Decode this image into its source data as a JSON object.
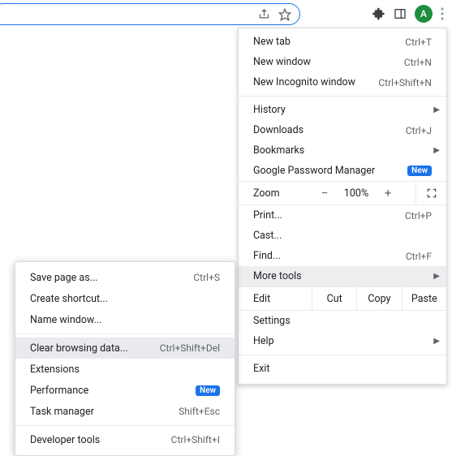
{
  "toolbar": {
    "avatar_letter": "A"
  },
  "menu": {
    "new_tab": {
      "label": "New tab",
      "accel": "Ctrl+T"
    },
    "new_window": {
      "label": "New window",
      "accel": "Ctrl+N"
    },
    "new_incognito": {
      "label": "New Incognito window",
      "accel": "Ctrl+Shift+N"
    },
    "history": {
      "label": "History"
    },
    "downloads": {
      "label": "Downloads",
      "accel": "Ctrl+J"
    },
    "bookmarks": {
      "label": "Bookmarks"
    },
    "password_mgr": {
      "label": "Google Password Manager",
      "badge": "New"
    },
    "zoom": {
      "label": "Zoom",
      "pct": "100%"
    },
    "print": {
      "label": "Print...",
      "accel": "Ctrl+P"
    },
    "cast": {
      "label": "Cast..."
    },
    "find": {
      "label": "Find...",
      "accel": "Ctrl+F"
    },
    "more_tools": {
      "label": "More tools"
    },
    "edit": {
      "label": "Edit",
      "cut": "Cut",
      "copy": "Copy",
      "paste": "Paste"
    },
    "settings": {
      "label": "Settings"
    },
    "help": {
      "label": "Help"
    },
    "exit": {
      "label": "Exit"
    }
  },
  "submenu": {
    "save_page": {
      "label": "Save page as...",
      "accel": "Ctrl+S"
    },
    "create_shortcut": {
      "label": "Create shortcut..."
    },
    "name_window": {
      "label": "Name window..."
    },
    "clear_data": {
      "label": "Clear browsing data...",
      "accel": "Ctrl+Shift+Del"
    },
    "extensions": {
      "label": "Extensions"
    },
    "performance": {
      "label": "Performance",
      "badge": "New"
    },
    "task_manager": {
      "label": "Task manager",
      "accel": "Shift+Esc"
    },
    "dev_tools": {
      "label": "Developer tools",
      "accel": "Ctrl+Shift+I"
    }
  }
}
